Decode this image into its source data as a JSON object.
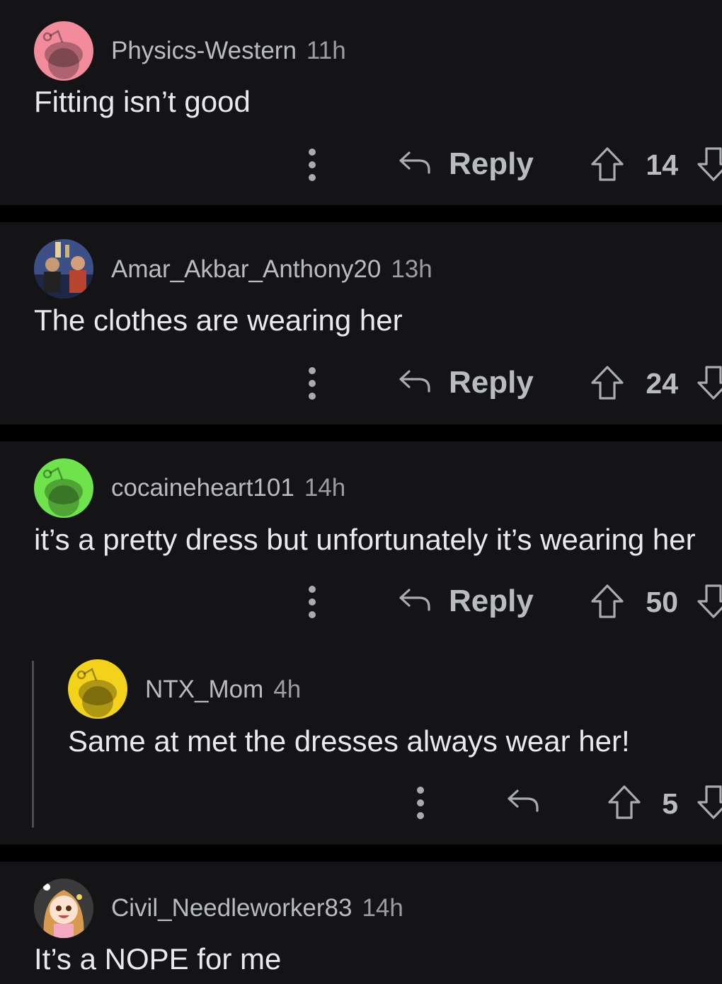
{
  "comments": [
    {
      "username": "Physics-Western",
      "age": "11h",
      "text": "Fitting isn’t good",
      "reply_label": "Reply",
      "score": "14",
      "avatar_color": "#f28b9c"
    },
    {
      "username": "Amar_Akbar_Anthony20",
      "age": "13h",
      "text": "The clothes are wearing her",
      "reply_label": "Reply",
      "score": "24",
      "avatar_color": "#6e7fa8"
    },
    {
      "username": "cocaineheart101",
      "age": "14h",
      "text": "it’s a pretty dress but unfortunately it’s wearing her",
      "reply_label": "Reply",
      "score": "50",
      "avatar_color": "#6fe34c"
    },
    {
      "username": "NTX_Mom",
      "age": "4h",
      "text": "Same at met the dresses always wear her!",
      "score": "5",
      "avatar_color": "#f2d21a"
    },
    {
      "username": "Civil_Needleworker83",
      "age": "14h",
      "text": "It’s a NOPE for me",
      "avatar_color": "#3a3a3a"
    }
  ],
  "icons": {
    "more": "more-vertical-icon",
    "reply": "reply-arrow-icon",
    "upvote": "upvote-arrow-icon",
    "downvote": "downvote-arrow-icon"
  }
}
